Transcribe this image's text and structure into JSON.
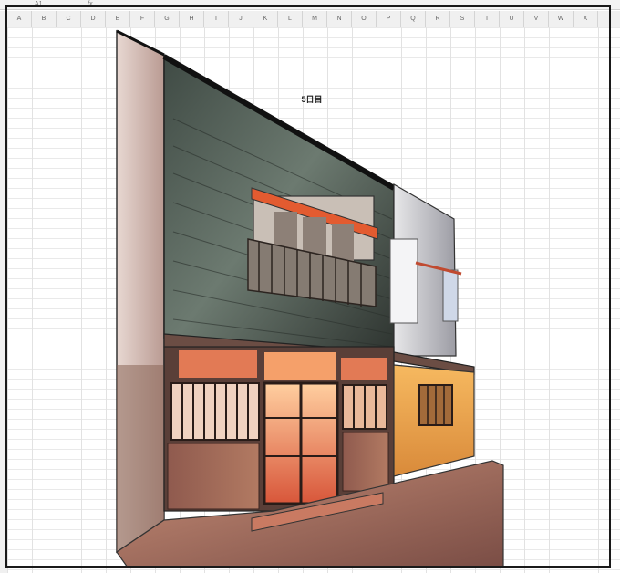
{
  "formula_bar": {
    "cell_ref": "A1",
    "fx": "fx"
  },
  "columns": [
    "A",
    "B",
    "C",
    "D",
    "E",
    "F",
    "G",
    "H",
    "I",
    "J",
    "K",
    "L",
    "M",
    "N",
    "O",
    "P",
    "Q",
    "R",
    "S",
    "T",
    "U",
    "V",
    "W",
    "X"
  ],
  "sheet_title": "5日目"
}
